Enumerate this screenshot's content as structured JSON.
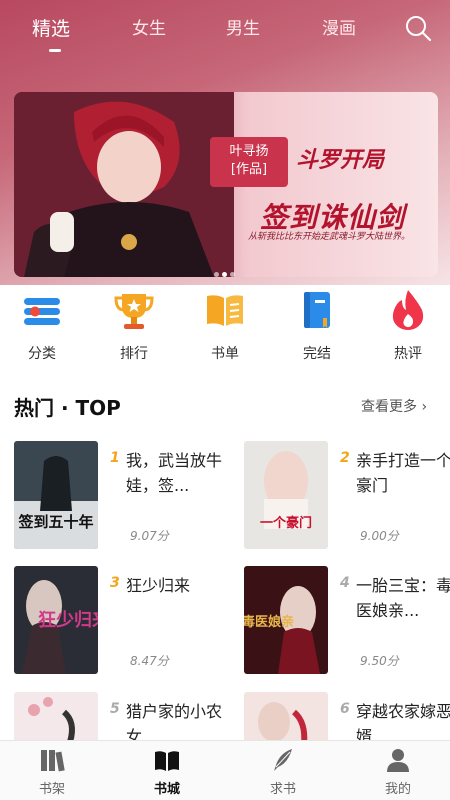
{
  "top_nav": {
    "tabs": [
      "精选",
      "女生",
      "男生",
      "漫画"
    ],
    "active_tab": "精选",
    "search_icon": "search-icon"
  },
  "banner": {
    "author_tag": "叶寻扬",
    "author_sub": "[作品]",
    "title_line1": "斗罗开局",
    "title_line2": "签到诛仙剑",
    "subtitle": "从斩我比比东开始走武魂斗罗大陆世界。"
  },
  "categories": [
    {
      "label": "分类",
      "icon": "category-list-icon",
      "color": "#2b8be8"
    },
    {
      "label": "排行",
      "icon": "trophy-icon",
      "color": "#f5a623"
    },
    {
      "label": "书单",
      "icon": "open-book-icon",
      "color": "#f5a623"
    },
    {
      "label": "完结",
      "icon": "finished-book-icon",
      "color": "#2b8be8"
    },
    {
      "label": "热评",
      "icon": "flame-icon",
      "color": "#f0344a"
    }
  ],
  "section": {
    "title": "热门 · TOP",
    "more": "查看更多"
  },
  "books": [
    {
      "rank": "1",
      "title": "我，武当放牛娃，签...",
      "score": "9.07分",
      "cover_text": "签到五十年"
    },
    {
      "rank": "2",
      "title": "亲手打造一个豪门",
      "score": "9.00分",
      "cover_text": "一个豪门"
    },
    {
      "rank": "3",
      "title": "狂少归来",
      "score": "8.47分",
      "cover_text": "狂少归来"
    },
    {
      "rank": "4",
      "title": "一胎三宝：毒医娘亲...",
      "score": "9.50分",
      "cover_text": "毒医娘亲"
    },
    {
      "rank": "5",
      "title": "猎户家的小农女",
      "score": "",
      "cover_text": ""
    },
    {
      "rank": "6",
      "title": "穿越农家嫁恶婿",
      "score": "",
      "cover_text": ""
    }
  ],
  "tabbar": {
    "items": [
      {
        "label": "书架",
        "icon": "bookshelf-icon"
      },
      {
        "label": "书城",
        "icon": "bookstore-icon"
      },
      {
        "label": "求书",
        "icon": "quill-icon"
      },
      {
        "label": "我的",
        "icon": "profile-icon"
      }
    ],
    "active": "书城"
  },
  "colors": {
    "accent_gold": "#f3a61a",
    "brand_red": "#c9344c"
  }
}
